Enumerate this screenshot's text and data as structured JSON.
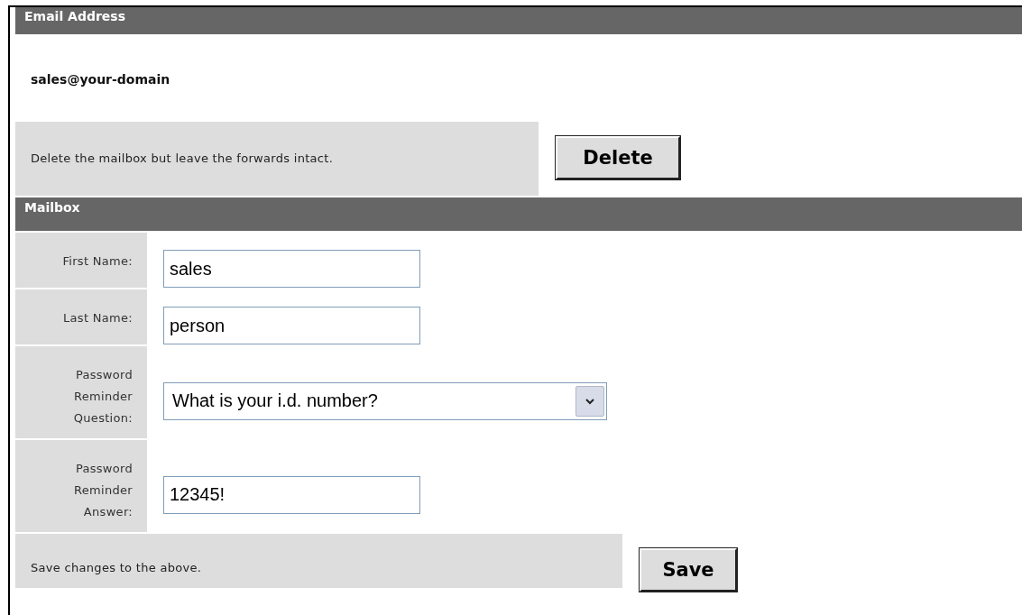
{
  "email_section": {
    "heading": "Email Address",
    "address": "sales@your-domain",
    "delete_note": "Delete the mailbox but leave the forwards intact.",
    "delete_button": "Delete"
  },
  "mailbox_section": {
    "heading": "Mailbox",
    "fields": [
      {
        "kind": "text",
        "label": "First Name:",
        "value": "sales"
      },
      {
        "kind": "text",
        "label": "Last Name:",
        "value": "person"
      },
      {
        "kind": "select",
        "label": "Password Reminder Question:",
        "value": "What is your i.d. number?"
      },
      {
        "kind": "text",
        "label": "Password Reminder Answer:",
        "value": "12345!"
      }
    ],
    "save_note": "Save changes to the above.",
    "save_button": "Save"
  }
}
